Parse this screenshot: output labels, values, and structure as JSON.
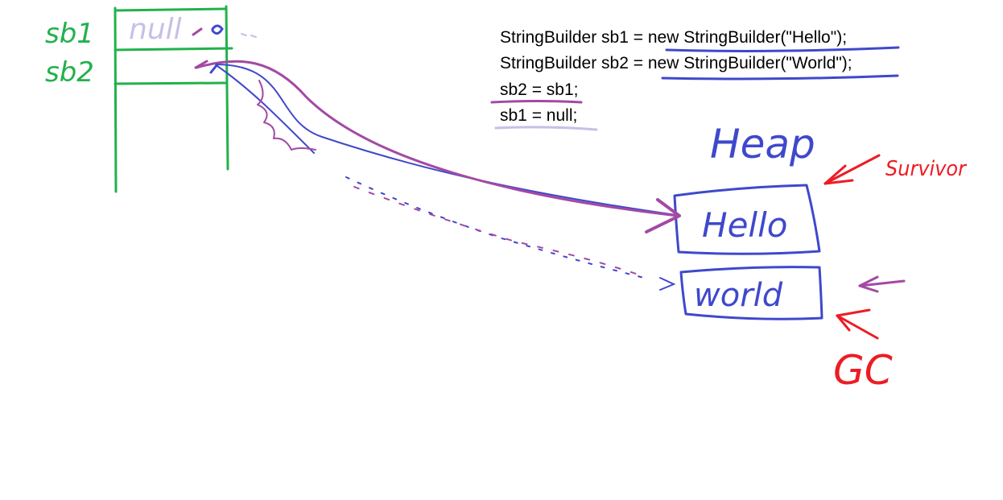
{
  "stack": {
    "var1_label": "sb1",
    "var2_label": "sb2",
    "var1_value": "null"
  },
  "code": {
    "line1": "StringBuilder sb1 = new StringBuilder(\"Hello\");",
    "line2": "StringBuilder sb2 = new StringBuilder(\"World\");",
    "line3": "sb2 = sb1;",
    "line4": "sb1 = null;"
  },
  "heap": {
    "title": "Heap",
    "object1": "Hello",
    "object2": "world"
  },
  "annotations": {
    "survivor": "Survivor",
    "gc": "GC"
  },
  "colors": {
    "stack": "#22b14c",
    "blue": "#3f48cc",
    "purple": "#a349a4",
    "lavender": "#c8bfe7",
    "red": "#ed1c24"
  }
}
